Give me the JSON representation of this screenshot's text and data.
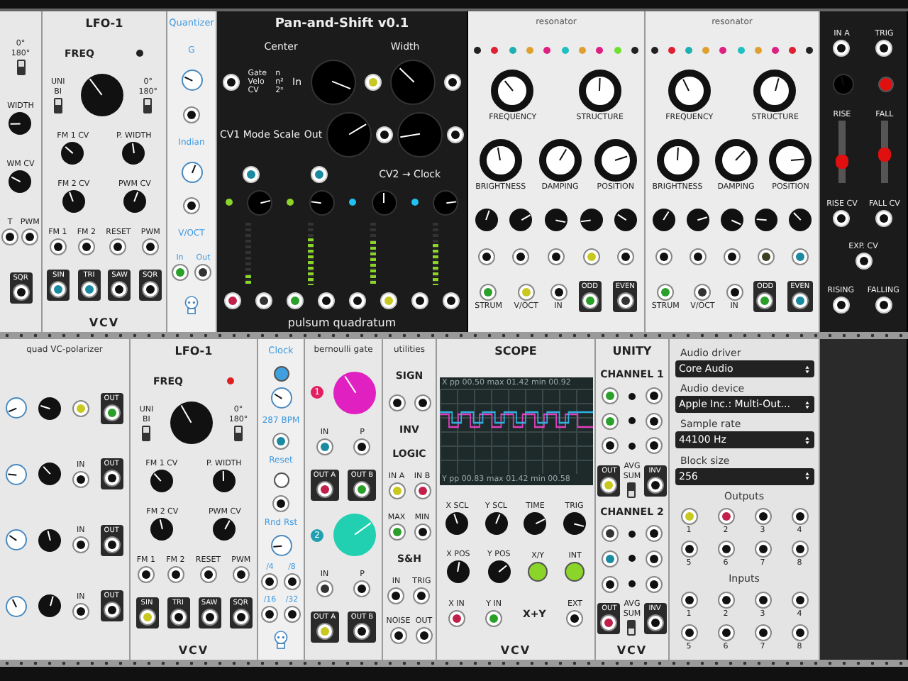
{
  "rows": [
    {
      "modules": [
        {
          "kind": "light",
          "sections": [
            {
              "controls": [
                {
                  "kind": "switch",
                  "top": "0°",
                  "label": "180°",
                  "on": true
                }
              ]
            },
            {
              "controls": [
                {
                  "kind": "knob",
                  "label": "WIDTH"
                }
              ]
            },
            {
              "controls": [
                {
                  "kind": "knob",
                  "label": "WM CV"
                }
              ]
            },
            {
              "controls": [
                {
                  "kind": "jack",
                  "label": "T"
                },
                {
                  "kind": "jack",
                  "label": "PWM"
                }
              ]
            },
            {
              "controls": [
                {
                  "kind": "out",
                  "label": "SQR"
                }
              ]
            }
          ]
        },
        {
          "kind": "light",
          "title": "LFO-1",
          "footer": "VCV",
          "sections": [
            {
              "controls": [
                {
                  "kind": "text",
                  "label": "FREQ"
                },
                {
                  "kind": "led",
                  "color": "#222222"
                }
              ]
            },
            {
              "controls": [
                {
                  "kind": "switch",
                  "top": "UNI",
                  "label": "BI",
                  "on": true
                },
                {
                  "kind": "knob_big"
                },
                {
                  "kind": "switch",
                  "top": "0°",
                  "label": "180°",
                  "on": true
                }
              ]
            },
            {
              "controls": [
                {
                  "kind": "knob",
                  "label": "FM 1 CV"
                },
                {
                  "kind": "knob",
                  "label": "P. WIDTH"
                }
              ]
            },
            {
              "controls": [
                {
                  "kind": "knob",
                  "label": "FM 2 CV"
                },
                {
                  "kind": "knob",
                  "label": "PWM CV"
                }
              ]
            },
            {
              "controls": [
                {
                  "kind": "jack",
                  "label": "FM 1"
                },
                {
                  "kind": "jack",
                  "label": "FM 2"
                },
                {
                  "kind": "jack",
                  "label": "RESET"
                },
                {
                  "kind": "jack",
                  "label": "PWM"
                }
              ]
            },
            {
              "controls": [
                {
                  "kind": "out",
                  "label": "SIN",
                  "color": "#1a8aa0"
                },
                {
                  "kind": "out",
                  "label": "TRI",
                  "color": "#1a8aa0"
                },
                {
                  "kind": "out",
                  "label": "SAW"
                },
                {
                  "kind": "out",
                  "label": "SQR"
                }
              ]
            }
          ]
        },
        {
          "kind": "blue",
          "title": "Quantizer",
          "sections": [
            {
              "controls": [
                {
                  "kind": "text",
                  "label": "G"
                }
              ]
            },
            {
              "controls": [
                {
                  "kind": "knob_white"
                }
              ]
            },
            {
              "controls": [
                {
                  "kind": "jack"
                }
              ]
            },
            {
              "controls": [
                {
                  "kind": "text",
                  "label": "Indian"
                }
              ]
            },
            {
              "controls": [
                {
                  "kind": "knob_white"
                }
              ]
            },
            {
              "controls": [
                {
                  "kind": "jack"
                }
              ]
            },
            {
              "controls": [
                {
                  "kind": "text",
                  "label": "V/OCT"
                }
              ]
            },
            {
              "controls": [
                {
                  "kind": "jack",
                  "label": "In",
                  "color": "#2aa02a"
                },
                {
                  "kind": "jack",
                  "label": "Out",
                  "color": "#333333"
                }
              ]
            },
            {
              "controls": [
                {
                  "kind": "robot"
                }
              ]
            }
          ]
        },
        {
          "kind": "dark",
          "title": "Pan-and-Shift v0.1",
          "footer": "pulsum quadratum",
          "sections": [
            {
              "controls": [
                {
                  "kind": "text",
                  "label": "Center"
                },
                {
                  "kind": "text",
                  "label": "Width"
                }
              ]
            },
            {
              "controls": [
                {
                  "kind": "jack"
                },
                {
                  "kind": "stack",
                  "labels": [
                    "Gate",
                    "Velo",
                    "CV"
                  ]
                },
                {
                  "kind": "stack",
                  "labels": [
                    "n",
                    "n²",
                    "2ⁿ"
                  ]
                },
                {
                  "kind": "text",
                  "label": "In"
                },
                {
                  "kind": "knob_big"
                },
                {
                  "kind": "jack",
                  "color": "#c8c820"
                },
                {
                  "kind": "knob_big"
                },
                {
                  "kind": "jack"
                }
              ]
            },
            {
              "controls": [
                {
                  "kind": "text",
                  "label": "CV1 Mode Scale"
                },
                {
                  "kind": "text",
                  "label": "Out"
                },
                {
                  "kind": "knob_big"
                },
                {
                  "kind": "jack"
                },
                {
                  "kind": "knob_big"
                },
                {
                  "kind": "jack"
                }
              ]
            },
            {
              "controls": [
                {
                  "kind": "jack",
                  "color": "#1a8aa0"
                },
                {
                  "kind": "jack",
                  "color": "#1a8aa0"
                },
                {
                  "kind": "text",
                  "label": "CV2 → Clock"
                }
              ]
            },
            {
              "controls": [
                {
                  "kind": "led",
                  "color": "#8bd42a"
                },
                {
                  "kind": "knob"
                },
                {
                  "kind": "led",
                  "color": "#8bd42a"
                },
                {
                  "kind": "knob"
                },
                {
                  "kind": "led",
                  "color": "#20c0f0"
                },
                {
                  "kind": "knob"
                },
                {
                  "kind": "led",
                  "color": "#20c0f0"
                },
                {
                  "kind": "knob"
                }
              ]
            },
            {
              "controls": [
                {
                  "kind": "meter",
                  "level": 0.15
                },
                {
                  "kind": "meter",
                  "level": 0.75
                },
                {
                  "kind": "meter",
                  "level": 0.7
                },
                {
                  "kind": "meter",
                  "level": 0.65
                }
              ]
            },
            {
              "controls": [
                {
                  "kind": "jack",
                  "color": "#c0204a"
                },
                {
                  "kind": "jack",
                  "color": "#333333"
                },
                {
                  "kind": "jack",
                  "color": "#2aa02a"
                },
                {
                  "kind": "jack"
                },
                {
                  "kind": "jack"
                },
                {
                  "kind": "jack",
                  "color": "#c8c820"
                },
                {
                  "kind": "jack"
                },
                {
                  "kind": "jack"
                }
              ]
            }
          ]
        },
        {
          "kind": "panel",
          "title": "resonator",
          "sections": [
            {
              "controls": [
                {
                  "kind": "led",
                  "color": "#222222"
                },
                {
                  "kind": "led",
                  "color": "#e02030"
                },
                {
                  "kind": "led",
                  "color": "#20b0b0"
                },
                {
                  "kind": "led",
                  "color": "#e0a030"
                },
                {
                  "kind": "led",
                  "color": "#e02080"
                },
                {
                  "kind": "led",
                  "color": "#20c0c0"
                },
                {
                  "kind": "led",
                  "color": "#e0a030"
                },
                {
                  "kind": "led",
                  "color": "#e02080"
                },
                {
                  "kind": "led",
                  "color": "#70e030"
                },
                {
                  "kind": "led",
                  "color": "#222222"
                }
              ]
            },
            {
              "controls": [
                {
                  "kind": "ring",
                  "label": "FREQUENCY"
                },
                {
                  "kind": "ring",
                  "label": "STRUCTURE"
                }
              ]
            },
            {
              "controls": [
                {
                  "kind": "ring",
                  "label": "BRIGHTNESS"
                },
                {
                  "kind": "ring",
                  "label": "DAMPING"
                },
                {
                  "kind": "ring",
                  "label": "POSITION"
                }
              ]
            },
            {
              "controls": [
                {
                  "kind": "knob"
                },
                {
                  "kind": "knob"
                },
                {
                  "kind": "knob"
                },
                {
                  "kind": "knob"
                },
                {
                  "kind": "knob"
                }
              ]
            },
            {
              "controls": [
                {
                  "kind": "jack"
                },
                {
                  "kind": "jack"
                },
                {
                  "kind": "jack"
                },
                {
                  "kind": "jack",
                  "color": "#c8c820"
                },
                {
                  "kind": "jack"
                }
              ]
            },
            {
              "controls": [
                {
                  "kind": "jack",
                  "label": "STRUM",
                  "color": "#2aa02a"
                },
                {
                  "kind": "jack",
                  "label": "V/OCT",
                  "color": "#c8c820"
                },
                {
                  "kind": "jack",
                  "label": "IN"
                },
                {
                  "kind": "out",
                  "label": "ODD",
                  "color": "#2aa02a"
                },
                {
                  "kind": "out",
                  "label": "EVEN",
                  "color": "#333333"
                }
              ]
            }
          ]
        },
        {
          "kind": "panel",
          "title": "resonator",
          "sections": [
            {
              "controls": [
                {
                  "kind": "led",
                  "color": "#222222"
                },
                {
                  "kind": "led",
                  "color": "#e02030"
                },
                {
                  "kind": "led",
                  "color": "#20b0b0"
                },
                {
                  "kind": "led",
                  "color": "#e0a030"
                },
                {
                  "kind": "led",
                  "color": "#e02080"
                },
                {
                  "kind": "led",
                  "color": "#20c0c0"
                },
                {
                  "kind": "led",
                  "color": "#e0a030"
                },
                {
                  "kind": "led",
                  "color": "#e02080"
                },
                {
                  "kind": "led",
                  "color": "#e02030"
                },
                {
                  "kind": "led",
                  "color": "#222222"
                }
              ]
            },
            {
              "controls": [
                {
                  "kind": "ring",
                  "label": "FREQUENCY"
                },
                {
                  "kind": "ring",
                  "label": "STRUCTURE"
                }
              ]
            },
            {
              "controls": [
                {
                  "kind": "ring",
                  "label": "BRIGHTNESS"
                },
                {
                  "kind": "ring",
                  "label": "DAMPING"
                },
                {
                  "kind": "ring",
                  "label": "POSITION"
                }
              ]
            },
            {
              "controls": [
                {
                  "kind": "knob"
                },
                {
                  "kind": "knob"
                },
                {
                  "kind": "knob"
                },
                {
                  "kind": "knob"
                },
                {
                  "kind": "knob"
                }
              ]
            },
            {
              "controls": [
                {
                  "kind": "jack"
                },
                {
                  "kind": "jack"
                },
                {
                  "kind": "jack"
                },
                {
                  "kind": "jack",
                  "color": "#3a4020"
                },
                {
                  "kind": "jack",
                  "color": "#1a8aa0"
                }
              ]
            },
            {
              "controls": [
                {
                  "kind": "jack",
                  "label": "STRUM",
                  "color": "#2aa02a"
                },
                {
                  "kind": "jack",
                  "label": "V/OCT",
                  "color": "#333333"
                },
                {
                  "kind": "jack",
                  "label": "IN"
                },
                {
                  "kind": "out",
                  "label": "ODD",
                  "color": "#2aa02a"
                },
                {
                  "kind": "out",
                  "label": "EVEN",
                  "color": "#1a8aa0"
                }
              ]
            }
          ]
        },
        {
          "kind": "dark",
          "sections": [
            {
              "controls": [
                {
                  "kind": "jack",
                  "label": "IN A"
                },
                {
                  "kind": "jack",
                  "label": "TRIG"
                }
              ]
            },
            {
              "controls": [
                {
                  "kind": "knob_white"
                },
                {
                  "kind": "button",
                  "color": "#e01010"
                }
              ]
            },
            {
              "controls": [
                {
                  "kind": "slider",
                  "label": "RISE",
                  "level": 0.35
                },
                {
                  "kind": "slider",
                  "label": "FALL",
                  "level": 0.45
                }
              ]
            },
            {
              "controls": [
                {
                  "kind": "jack",
                  "label": "RISE CV"
                },
                {
                  "kind": "jack",
                  "label": "FALL CV"
                }
              ]
            },
            {
              "controls": [
                {
                  "kind": "jack",
                  "label": "EXP. CV"
                }
              ]
            },
            {
              "controls": [
                {
                  "kind": "jack",
                  "label": "RISING"
                },
                {
                  "kind": "jack",
                  "label": "FALLING"
                }
              ]
            }
          ]
        }
      ]
    },
    {
      "modules": [
        {
          "kind": "small",
          "title": "quad VC-polarizer",
          "sections": [
            {
              "controls": [
                {
                  "kind": "knob_white"
                },
                {
                  "kind": "knob"
                },
                {
                  "kind": "jack",
                  "color": "#c8c820"
                },
                {
                  "kind": "out",
                  "label": "OUT",
                  "color": "#2aa02a"
                }
              ]
            },
            {
              "controls": [
                {
                  "kind": "knob_white"
                },
                {
                  "kind": "knob"
                },
                {
                  "kind": "jack",
                  "label": "IN"
                },
                {
                  "kind": "out",
                  "label": "OUT"
                }
              ]
            },
            {
              "controls": [
                {
                  "kind": "knob_white"
                },
                {
                  "kind": "knob"
                },
                {
                  "kind": "jack",
                  "label": "IN"
                },
                {
                  "kind": "out",
                  "label": "OUT"
                }
              ]
            },
            {
              "controls": [
                {
                  "kind": "knob_white"
                },
                {
                  "kind": "knob"
                },
                {
                  "kind": "jack",
                  "label": "IN"
                },
                {
                  "kind": "out",
                  "label": "OUT"
                }
              ]
            }
          ]
        },
        {
          "kind": "light",
          "title": "LFO-1",
          "footer": "VCV",
          "sections": [
            {
              "controls": [
                {
                  "kind": "text",
                  "label": "FREQ"
                },
                {
                  "kind": "led",
                  "color": "#e02020"
                }
              ]
            },
            {
              "controls": [
                {
                  "kind": "switch",
                  "top": "UNI",
                  "label": "BI",
                  "on": true
                },
                {
                  "kind": "knob_big"
                },
                {
                  "kind": "switch",
                  "top": "0°",
                  "label": "180°",
                  "on": true
                }
              ]
            },
            {
              "controls": [
                {
                  "kind": "knob",
                  "label": "FM 1 CV"
                },
                {
                  "kind": "knob",
                  "label": "P. WIDTH"
                }
              ]
            },
            {
              "controls": [
                {
                  "kind": "knob",
                  "label": "FM 2 CV"
                },
                {
                  "kind": "knob",
                  "label": "PWM CV"
                }
              ]
            },
            {
              "controls": [
                {
                  "kind": "jack",
                  "label": "FM 1"
                },
                {
                  "kind": "jack",
                  "label": "FM 2"
                },
                {
                  "kind": "jack",
                  "label": "RESET"
                },
                {
                  "kind": "jack",
                  "label": "PWM"
                }
              ]
            },
            {
              "controls": [
                {
                  "kind": "out",
                  "label": "SIN",
                  "color": "#c8c820"
                },
                {
                  "kind": "out",
                  "label": "TRI"
                },
                {
                  "kind": "out",
                  "label": "SAW"
                },
                {
                  "kind": "out",
                  "label": "SQR"
                }
              ]
            }
          ]
        },
        {
          "kind": "blue",
          "title": "Clock",
          "sections": [
            {
              "controls": [
                {
                  "kind": "button",
                  "color": "#3fa0e0"
                }
              ]
            },
            {
              "controls": [
                {
                  "kind": "knob_white"
                }
              ]
            },
            {
              "controls": [
                {
                  "kind": "text",
                  "label": "287 BPM"
                }
              ]
            },
            {
              "controls": [
                {
                  "kind": "jack",
                  "color": "#1a8aa0"
                }
              ]
            },
            {
              "controls": [
                {
                  "kind": "text",
                  "label": "Reset"
                }
              ]
            },
            {
              "controls": [
                {
                  "kind": "button"
                }
              ]
            },
            {
              "controls": [
                {
                  "kind": "jack"
                }
              ]
            },
            {
              "controls": [
                {
                  "kind": "text",
                  "label": "Rnd Rst"
                }
              ]
            },
            {
              "controls": [
                {
                  "kind": "knob_white"
                }
              ]
            },
            {
              "controls": [
                {
                  "kind": "jack",
                  "label": "/4"
                },
                {
                  "kind": "jack",
                  "label": "/8"
                }
              ]
            },
            {
              "controls": [
                {
                  "kind": "jack",
                  "label": "/16"
                },
                {
                  "kind": "jack",
                  "label": "/32"
                }
              ]
            },
            {
              "controls": [
                {
                  "kind": "robot"
                }
              ]
            }
          ]
        },
        {
          "kind": "small",
          "title": "bernoulli gate",
          "sections": [
            {
              "controls": [
                {
                  "kind": "badge",
                  "label": "1",
                  "color": "#e02060"
                },
                {
                  "kind": "knob_big",
                  "color": "#e020c0"
                }
              ]
            },
            {
              "controls": [
                {
                  "kind": "jack",
                  "label": "IN",
                  "color": "#1a8aa0"
                },
                {
                  "kind": "jack",
                  "label": "P"
                }
              ]
            },
            {
              "controls": [
                {
                  "kind": "out",
                  "label": "OUT A",
                  "color": "#c0204a"
                },
                {
                  "kind": "out",
                  "label": "OUT B",
                  "color": "#2aa02a"
                }
              ]
            },
            {
              "controls": [
                {
                  "kind": "badge",
                  "label": "2",
                  "color": "#20a0b0"
                },
                {
                  "kind": "knob_big",
                  "color": "#20d0b0"
                }
              ]
            },
            {
              "controls": [
                {
                  "kind": "jack",
                  "label": "IN",
                  "color": "#333333"
                },
                {
                  "kind": "jack",
                  "label": "P"
                }
              ]
            },
            {
              "controls": [
                {
                  "kind": "out",
                  "label": "OUT A",
                  "color": "#c8c820"
                },
                {
                  "kind": "out",
                  "label": "OUT B"
                }
              ]
            }
          ]
        },
        {
          "kind": "small",
          "title": "utilities",
          "sections": [
            {
              "controls": [
                {
                  "kind": "text",
                  "label": "SIGN"
                }
              ]
            },
            {
              "controls": [
                {
                  "kind": "jack"
                },
                {
                  "kind": "jack"
                }
              ]
            },
            {
              "controls": [
                {
                  "kind": "text",
                  "label": "INV"
                }
              ]
            },
            {
              "controls": [
                {
                  "kind": "text",
                  "label": "LOGIC"
                }
              ]
            },
            {
              "controls": [
                {
                  "kind": "jack",
                  "label": "IN A",
                  "color": "#c8c820"
                },
                {
                  "kind": "jack",
                  "label": "IN B",
                  "color": "#c0204a"
                }
              ]
            },
            {
              "controls": [
                {
                  "kind": "jack",
                  "label": "MAX",
                  "color": "#2aa02a"
                },
                {
                  "kind": "jack",
                  "label": "MIN"
                }
              ]
            },
            {
              "controls": [
                {
                  "kind": "text",
                  "label": "S&H"
                }
              ]
            },
            {
              "controls": [
                {
                  "kind": "jack",
                  "label": "IN"
                },
                {
                  "kind": "jack",
                  "label": "TRIG"
                }
              ]
            },
            {
              "controls": [
                {
                  "kind": "jack",
                  "label": "NOISE"
                },
                {
                  "kind": "jack",
                  "label": "OUT"
                }
              ]
            }
          ]
        },
        {
          "kind": "light",
          "title": "SCOPE",
          "footer": "VCV",
          "sections": [
            {
              "controls": [
                {
                  "kind": "screen",
                  "x_readout": "X pp 00.50 max 01.42 min 00.92",
                  "y_readout": "Y pp 00.83 max 01.42 min 00.58"
                }
              ]
            },
            {
              "controls": [
                {
                  "kind": "knob",
                  "label": "X SCL"
                },
                {
                  "kind": "knob",
                  "label": "Y SCL"
                },
                {
                  "kind": "knob",
                  "label": "TIME"
                },
                {
                  "kind": "knob",
                  "label": "TRIG"
                }
              ]
            },
            {
              "controls": [
                {
                  "kind": "knob",
                  "label": "X POS"
                },
                {
                  "kind": "knob",
                  "label": "Y POS"
                },
                {
                  "kind": "button",
                  "label": "X/Y",
                  "color": "#8bd42a"
                },
                {
                  "kind": "button",
                  "label": "INT",
                  "color": "#8bd42a"
                }
              ]
            },
            {
              "controls": [
                {
                  "kind": "jack",
                  "label": "X IN",
                  "color": "#c0204a"
                },
                {
                  "kind": "jack",
                  "label": "Y IN",
                  "color": "#2aa02a"
                },
                {
                  "kind": "text",
                  "label": "X+Y"
                },
                {
                  "kind": "jack",
                  "label": "EXT"
                }
              ]
            }
          ]
        },
        {
          "kind": "light",
          "title": "UNITY",
          "footer": "VCV",
          "sections": [
            {
              "controls": [
                {
                  "kind": "text",
                  "label": "CHANNEL 1"
                }
              ]
            },
            {
              "controls": [
                {
                  "kind": "jack",
                  "color": "#2aa02a"
                },
                {
                  "kind": "led",
                  "color": "#111111"
                },
                {
                  "kind": "jack"
                }
              ]
            },
            {
              "controls": [
                {
                  "kind": "jack",
                  "color": "#2aa02a"
                },
                {
                  "kind": "led",
                  "color": "#111111"
                },
                {
                  "kind": "jack"
                }
              ]
            },
            {
              "controls": [
                {
                  "kind": "jack"
                },
                {
                  "kind": "led",
                  "color": "#111111"
                },
                {
                  "kind": "jack"
                }
              ]
            },
            {
              "controls": [
                {
                  "kind": "out",
                  "label": "OUT",
                  "color": "#c8c820"
                },
                {
                  "kind": "switch",
                  "top": "AVG",
                  "label": "SUM",
                  "on": false
                },
                {
                  "kind": "out",
                  "label": "INV"
                }
              ]
            },
            {
              "controls": [
                {
                  "kind": "text",
                  "label": "CHANNEL 2"
                }
              ]
            },
            {
              "controls": [
                {
                  "kind": "jack",
                  "color": "#333333"
                },
                {
                  "kind": "led",
                  "color": "#111111"
                },
                {
                  "kind": "jack"
                }
              ]
            },
            {
              "controls": [
                {
                  "kind": "jack",
                  "color": "#1a8aa0"
                },
                {
                  "kind": "led",
                  "color": "#111111"
                },
                {
                  "kind": "jack"
                }
              ]
            },
            {
              "controls": [
                {
                  "kind": "jack"
                },
                {
                  "kind": "led",
                  "color": "#111111"
                },
                {
                  "kind": "jack"
                }
              ]
            },
            {
              "controls": [
                {
                  "kind": "out",
                  "label": "OUT",
                  "color": "#c0204a"
                },
                {
                  "kind": "switch",
                  "top": "AVG",
                  "label": "SUM",
                  "on": false
                },
                {
                  "kind": "out",
                  "label": "INV"
                }
              ]
            }
          ]
        },
        {
          "kind": "audio",
          "sections": [
            {
              "controls": [
                {
                  "kind": "select",
                  "label": "Audio driver",
                  "value": "Core Audio"
                }
              ]
            },
            {
              "controls": [
                {
                  "kind": "select",
                  "label": "Audio device",
                  "value": "Apple Inc.: Multi-Out..."
                }
              ]
            },
            {
              "controls": [
                {
                  "kind": "select",
                  "label": "Sample rate",
                  "value": "44100 Hz"
                }
              ]
            },
            {
              "controls": [
                {
                  "kind": "select",
                  "label": "Block size",
                  "value": "256"
                }
              ]
            },
            {
              "controls": [
                {
                  "kind": "text",
                  "label": "Outputs"
                }
              ]
            },
            {
              "controls": [
                {
                  "kind": "jack",
                  "label": "1",
                  "color": "#c8c820"
                },
                {
                  "kind": "jack",
                  "label": "2",
                  "color": "#c0204a"
                },
                {
                  "kind": "jack",
                  "label": "3"
                },
                {
                  "kind": "jack",
                  "label": "4"
                }
              ]
            },
            {
              "controls": [
                {
                  "kind": "jack",
                  "label": "5"
                },
                {
                  "kind": "jack",
                  "label": "6"
                },
                {
                  "kind": "jack",
                  "label": "7"
                },
                {
                  "kind": "jack",
                  "label": "8"
                }
              ]
            },
            {
              "controls": [
                {
                  "kind": "text",
                  "label": "Inputs"
                }
              ]
            },
            {
              "controls": [
                {
                  "kind": "jack",
                  "label": "1"
                },
                {
                  "kind": "jack",
                  "label": "2"
                },
                {
                  "kind": "jack",
                  "label": "3"
                },
                {
                  "kind": "jack",
                  "label": "4"
                }
              ]
            },
            {
              "controls": [
                {
                  "kind": "jack",
                  "label": "5"
                },
                {
                  "kind": "jack",
                  "label": "6"
                },
                {
                  "kind": "jack",
                  "label": "7"
                },
                {
                  "kind": "jack",
                  "label": "8"
                }
              ]
            }
          ]
        },
        {
          "kind": "blank"
        }
      ]
    }
  ]
}
